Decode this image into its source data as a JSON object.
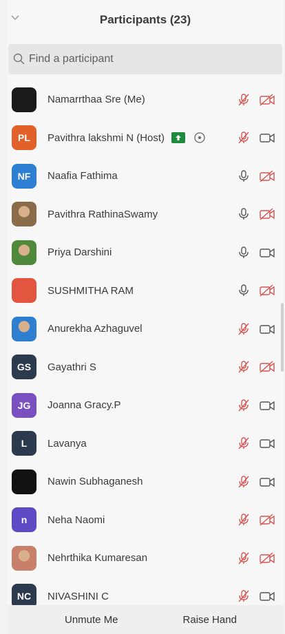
{
  "header": {
    "title": "Participants (23)"
  },
  "search": {
    "placeholder": "Find a participant"
  },
  "footer": {
    "unmute_label": "Unmute Me",
    "raise_hand_label": "Raise Hand"
  },
  "colors": {
    "muted_red": "#d9534f",
    "icon_gray": "#555555",
    "share_green": "#1c8b3b"
  },
  "participants": [
    {
      "name": "Namarrthaa Sre (Me)",
      "initials": "",
      "avatar_color": "#1a1a1a",
      "mic": "muted",
      "video": "off"
    },
    {
      "name": "Pavithra lakshmi N (Host)",
      "initials": "PL",
      "avatar_color": "#e2612a",
      "mic": "muted",
      "video": "on",
      "sharing": true,
      "recording": true
    },
    {
      "name": "Naafia Fathima",
      "initials": "NF",
      "avatar_color": "#2d7fd4",
      "mic": "on",
      "video": "off"
    },
    {
      "name": "Pavithra RathinaSwamy",
      "initials": "",
      "avatar_color": "#8a6b4a",
      "avatar_kind": "photo",
      "mic": "on",
      "video": "off"
    },
    {
      "name": "Priya Darshini",
      "initials": "",
      "avatar_color": "#4f8a3a",
      "avatar_kind": "photo",
      "mic": "on",
      "video": "on"
    },
    {
      "name": "SUSHMITHA RAM",
      "initials": "",
      "avatar_color": "#e2553f",
      "mic": "on",
      "video": "off"
    },
    {
      "name": "Anurekha Azhaguvel",
      "initials": "",
      "avatar_color": "#2f7fd0",
      "avatar_kind": "photo",
      "mic": "muted",
      "video": "on"
    },
    {
      "name": "Gayathri S",
      "initials": "GS",
      "avatar_color": "#2c3a4e",
      "mic": "muted",
      "video": "off"
    },
    {
      "name": "Joanna Gracy.P",
      "initials": "JG",
      "avatar_color": "#7a4fc0",
      "mic": "muted",
      "video": "on"
    },
    {
      "name": "Lavanya",
      "initials": "L",
      "avatar_color": "#2c3a4e",
      "mic": "muted",
      "video": "on"
    },
    {
      "name": "Nawin Subhaganesh",
      "initials": "",
      "avatar_color": "#111111",
      "mic": "muted",
      "video": "on"
    },
    {
      "name": "Neha Naomi",
      "initials": "n",
      "avatar_color": "#5b4bc4",
      "mic": "muted",
      "video": "off"
    },
    {
      "name": "Nehrthika Kumaresan",
      "initials": "",
      "avatar_color": "#c9806a",
      "avatar_kind": "photo",
      "mic": "muted",
      "video": "off"
    },
    {
      "name": "NIVASHINI C",
      "initials": "NC",
      "avatar_color": "#2c3a4e",
      "mic": "muted",
      "video": "on"
    }
  ]
}
